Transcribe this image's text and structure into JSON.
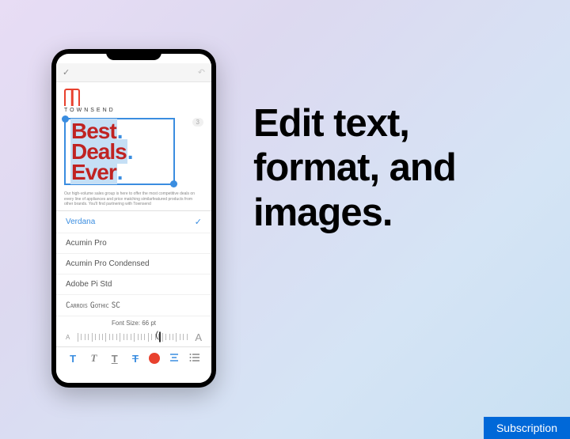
{
  "phone": {
    "brand": {
      "name": "TOWNSEND"
    },
    "headline": {
      "line1": "Best",
      "line2": "Deals",
      "line3": "Ever",
      "dot": "."
    },
    "body_text": "Our high-volume sales group is here to offer the most competitive deals on every line of appliances and price matching similarfeatured products from other brands. You'll find partnering with Townsend",
    "page_number": "3",
    "font_panel": {
      "selected": "Verdana",
      "items": [
        "Verdana",
        "Acumin Pro",
        "Acumin Pro Condensed",
        "Adobe Pi Std",
        "Carrois Gothic SC"
      ],
      "size_label": "Font Size: 66 pt",
      "slider_small": "A",
      "slider_large": "A"
    },
    "toolbar": {
      "bold": "T",
      "italic": "T",
      "underline": "T",
      "strike": "T"
    }
  },
  "ad": {
    "headline": "Edit text, format, and images."
  },
  "badge": {
    "label": "Subscription"
  }
}
